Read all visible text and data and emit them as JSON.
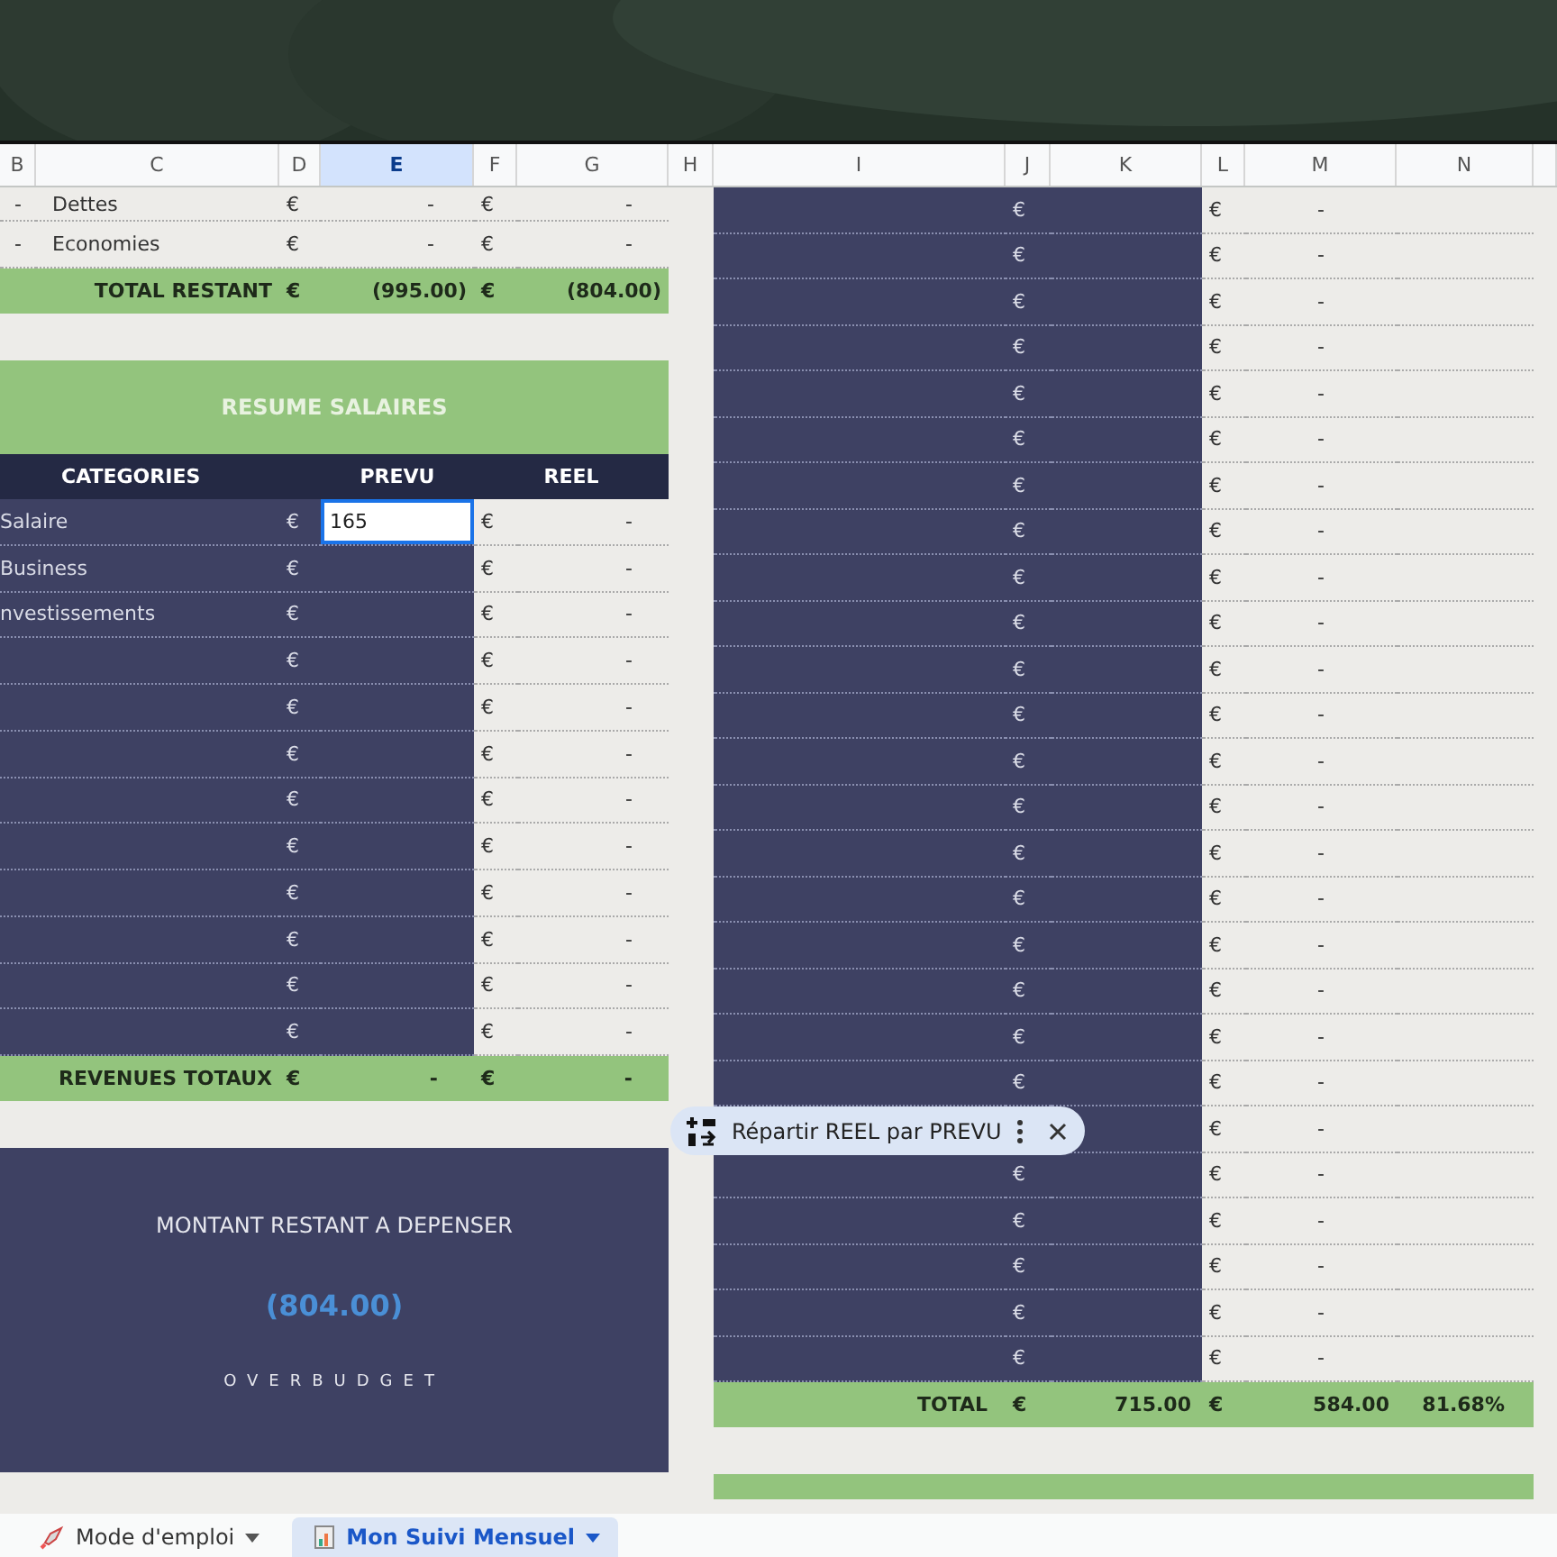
{
  "column_headers": [
    {
      "label": "B",
      "selected": false
    },
    {
      "label": "C",
      "selected": false
    },
    {
      "label": "D",
      "selected": false
    },
    {
      "label": "E",
      "selected": true
    },
    {
      "label": "F",
      "selected": false
    },
    {
      "label": "G",
      "selected": false
    },
    {
      "label": "H",
      "selected": false
    },
    {
      "label": "I",
      "selected": false
    },
    {
      "label": "J",
      "selected": false
    },
    {
      "label": "K",
      "selected": false
    },
    {
      "label": "L",
      "selected": false
    },
    {
      "label": "M",
      "selected": false
    },
    {
      "label": "N",
      "selected": false
    }
  ],
  "expense_rows": [
    {
      "col_b": "-",
      "label": "Dettes",
      "cur_planned": "€",
      "planned": "-",
      "cur_actual": "€",
      "actual": "-"
    },
    {
      "col_b": "-",
      "label": "Economies",
      "cur_planned": "€",
      "planned": "-",
      "cur_actual": "€",
      "actual": "-"
    }
  ],
  "expense_total": {
    "label": "TOTAL RESTANT",
    "cur_planned": "€",
    "planned": "(995.00)",
    "cur_actual": "€",
    "actual": "(804.00)"
  },
  "salary_summary": {
    "title": "RESUME SALAIRES",
    "columns": [
      "CATEGORIES",
      "PREVU",
      "REEL"
    ],
    "rows": [
      {
        "category": "Salaire",
        "cur_planned": "€",
        "planned": "165",
        "editing": true,
        "cur_actual": "€",
        "actual": "-"
      },
      {
        "category": "Business",
        "cur_planned": "€",
        "editing": false,
        "cur_actual": "€",
        "actual": "-"
      },
      {
        "category": "nvestissements",
        "cur_planned": "€",
        "editing": false,
        "cur_actual": "€",
        "actual": "-"
      },
      {
        "cur_planned": "€",
        "editing": false,
        "cur_actual": "€",
        "actual": "-"
      },
      {
        "cur_planned": "€",
        "editing": false,
        "cur_actual": "€",
        "actual": "-"
      },
      {
        "cur_planned": "€",
        "editing": false,
        "cur_actual": "€",
        "actual": "-"
      },
      {
        "cur_planned": "€",
        "editing": false,
        "cur_actual": "€",
        "actual": "-"
      },
      {
        "cur_planned": "€",
        "editing": false,
        "cur_actual": "€",
        "actual": "-"
      },
      {
        "cur_planned": "€",
        "editing": false,
        "cur_actual": "€",
        "actual": "-"
      },
      {
        "cur_planned": "€",
        "editing": false,
        "cur_actual": "€",
        "actual": "-"
      },
      {
        "cur_planned": "€",
        "editing": false,
        "cur_actual": "€",
        "actual": "-"
      },
      {
        "cur_planned": "€",
        "editing": false,
        "cur_actual": "€",
        "actual": "-"
      }
    ],
    "total": {
      "label": "REVENUES TOTAUX",
      "cur_planned": "€",
      "planned": "-",
      "cur_actual": "€",
      "actual": "-"
    }
  },
  "remaining": {
    "title": "MONTANT RESTANT A DEPENSER",
    "amount": "(804.00)",
    "status": "OVERBUDGET"
  },
  "detail_table": {
    "rows": [
      {
        "cur_planned": "€",
        "cur_actual": "€",
        "actual": "-"
      },
      {
        "cur_planned": "€",
        "cur_actual": "€",
        "actual": "-"
      },
      {
        "cur_planned": "€",
        "cur_actual": "€",
        "actual": "-"
      },
      {
        "cur_planned": "€",
        "cur_actual": "€",
        "actual": "-"
      },
      {
        "cur_planned": "€",
        "cur_actual": "€",
        "actual": "-"
      },
      {
        "cur_planned": "€",
        "cur_actual": "€",
        "actual": "-"
      },
      {
        "cur_planned": "€",
        "cur_actual": "€",
        "actual": "-"
      },
      {
        "cur_planned": "€",
        "cur_actual": "€",
        "actual": "-"
      },
      {
        "cur_planned": "€",
        "cur_actual": "€",
        "actual": "-"
      },
      {
        "cur_planned": "€",
        "cur_actual": "€",
        "actual": "-"
      },
      {
        "cur_planned": "€",
        "cur_actual": "€",
        "actual": "-"
      },
      {
        "cur_planned": "€",
        "cur_actual": "€",
        "actual": "-"
      },
      {
        "cur_planned": "€",
        "cur_actual": "€",
        "actual": "-"
      },
      {
        "cur_planned": "€",
        "cur_actual": "€",
        "actual": "-"
      },
      {
        "cur_planned": "€",
        "cur_actual": "€",
        "actual": "-"
      },
      {
        "cur_planned": "€",
        "cur_actual": "€",
        "actual": "-"
      },
      {
        "cur_planned": "€",
        "cur_actual": "€",
        "actual": "-"
      },
      {
        "cur_planned": "€",
        "cur_actual": "€",
        "actual": "-"
      },
      {
        "cur_planned": "€",
        "cur_actual": "€",
        "actual": "-"
      },
      {
        "cur_planned": "€",
        "cur_actual": "€",
        "actual": "-"
      },
      {
        "cur_actual": "€",
        "actual": "-"
      },
      {
        "cur_planned": "€",
        "cur_actual": "€",
        "actual": "-"
      },
      {
        "cur_planned": "€",
        "cur_actual": "€",
        "actual": "-"
      },
      {
        "cur_planned": "€",
        "cur_actual": "€",
        "actual": "-"
      },
      {
        "cur_planned": "€",
        "cur_actual": "€",
        "actual": "-"
      },
      {
        "cur_planned": "€",
        "cur_actual": "€",
        "actual": "-"
      }
    ],
    "total": {
      "label": "TOTAL",
      "cur_planned": "€",
      "planned": "715.00",
      "cur_actual": "€",
      "actual": "584.00",
      "percent": "81.68%"
    }
  },
  "suggestion_chip": {
    "label": "Répartir REEL par PREVU"
  },
  "sheet_tabs": [
    {
      "label": "Mode d'emploi",
      "selected": false
    },
    {
      "label": "Mon Suivi Mensuel",
      "selected": true
    }
  ]
}
